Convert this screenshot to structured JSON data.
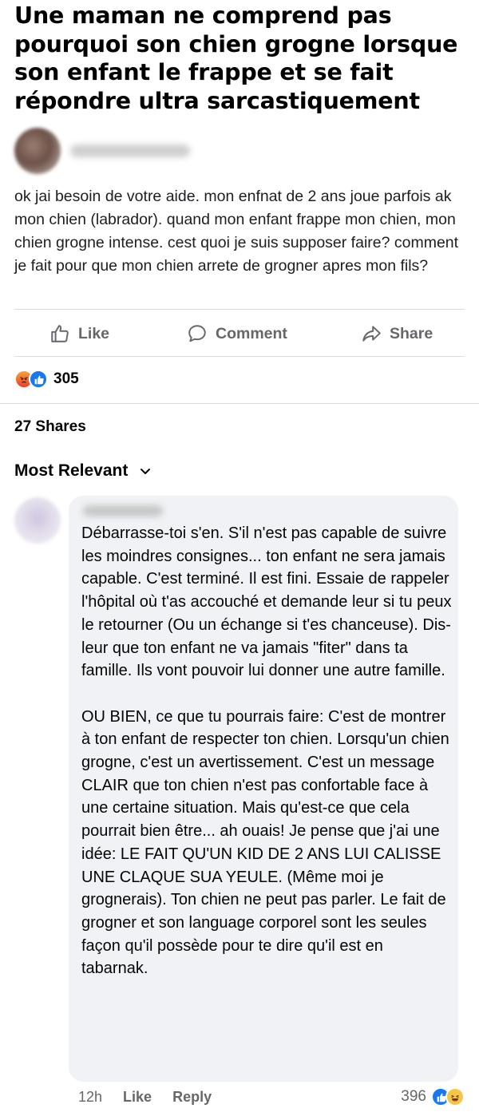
{
  "headline": "Une maman ne comprend pas pourquoi son chien grogne lorsque son enfant le frappe et se fait répondre ultra sarcastiquement",
  "post": {
    "body": "ok jai besoin de votre aide. mon enfnat de 2 ans joue parfois ak mon chien (labrador). quand mon enfant frappe mon chien, mon chien grogne intense. cest quoi je suis supposer faire? comment je fait pour que mon chien arrete de grogner apres mon fils?"
  },
  "actions": {
    "like": "Like",
    "comment": "Comment",
    "share": "Share"
  },
  "reactions": {
    "count": "305",
    "icons": [
      "angry-reaction-icon",
      "like-reaction-icon"
    ]
  },
  "shares": "27 Shares",
  "sort_label": "Most Relevant",
  "comment": {
    "paragraph1": "Débarrasse-toi s'en. S'il n'est pas capable de suivre les moindres consignes... ton enfant ne sera jamais capable. C'est terminé. Il est fini. Essaie de rappeler l'hôpital où t'as accouché et demande leur si tu peux le retourner (Ou un échange si t'es chanceuse). Dis-leur que ton enfant ne va jamais \"fiter\" dans ta famille. Ils vont pouvoir lui donner une autre famille.",
    "paragraph2": "OU BIEN, ce que tu pourrais faire: C'est de montrer à ton enfant de respecter ton chien. Lorsqu'un chien grogne, c'est un avertissement. C'est un message CLAIR que ton chien n'est pas confortable face à une certaine situation. Mais qu'est-ce que cela pourrait bien être... ah ouais! Je pense que j'ai une idée: LE FAIT QU'UN KID DE 2 ANS LUI CALISSE UNE CLAQUE SUA YEULE. (Même moi je grognerais). Ton chien ne peut pas parler. Le fait de grogner et son language corporel sont les seules façon qu'il possède pour te dire qu'il est en tabarnak.",
    "time": "12h",
    "like": "Like",
    "reply": "Reply",
    "reaction_count": "396",
    "reaction_icons": [
      "like-reaction-icon",
      "haha-reaction-icon"
    ]
  },
  "colors": {
    "like_blue": "#1877f2",
    "bubble_bg": "#f0f2f5",
    "secondary_text": "#65676b"
  }
}
